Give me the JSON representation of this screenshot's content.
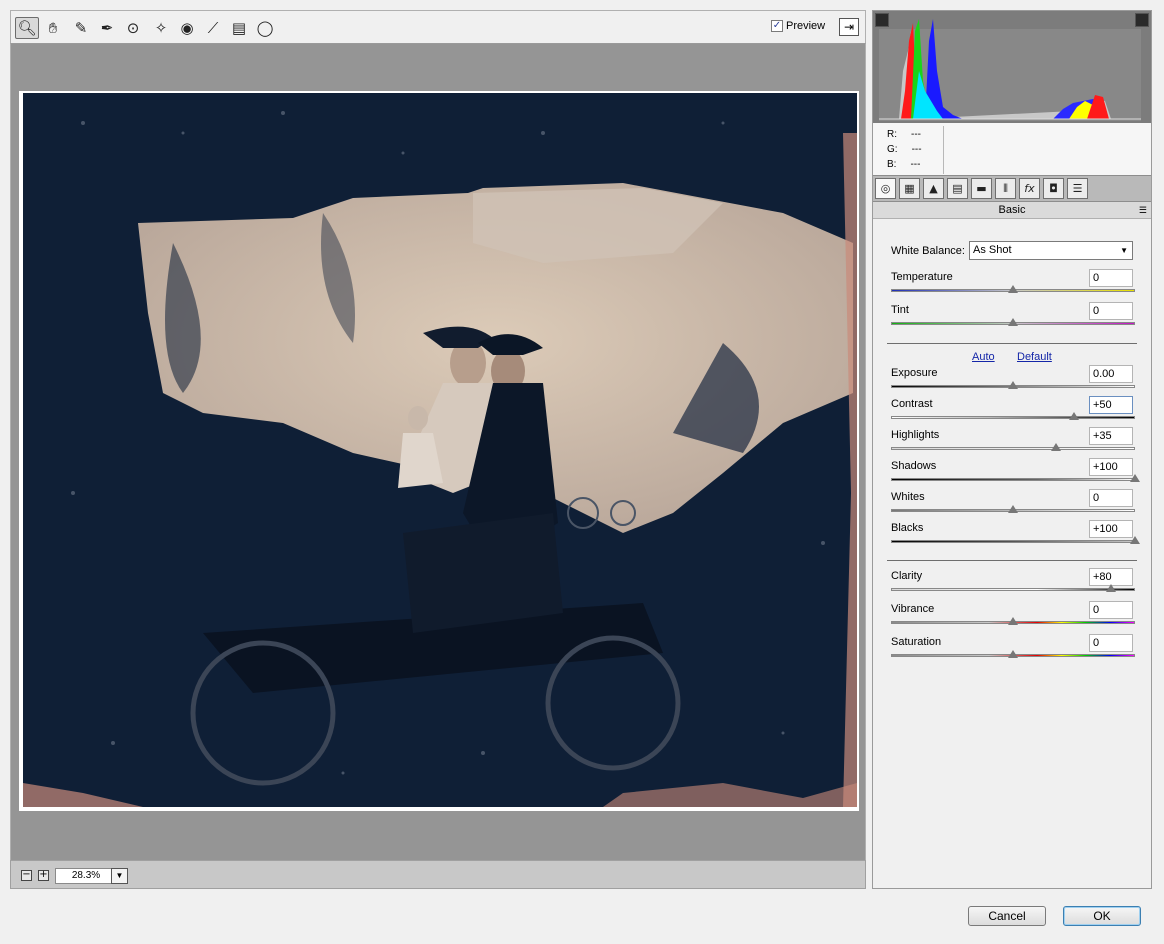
{
  "toolbar": {
    "preview_label": "Preview",
    "preview_checked": "✓"
  },
  "zoom": {
    "value": "28.3%",
    "minus": "−",
    "plus": "+"
  },
  "readout": {
    "r_label": "R:",
    "r_value": "---",
    "g_label": "G:",
    "g_value": "---",
    "b_label": "B:",
    "b_value": "---"
  },
  "panel": {
    "title": "Basic",
    "white_balance_label": "White Balance:",
    "white_balance_value": "As Shot",
    "auto_link": "Auto",
    "default_link": "Default",
    "sliders": [
      {
        "label": "Temperature",
        "value": "0",
        "position": 0.5
      },
      {
        "label": "Tint",
        "value": "0",
        "position": 0.5
      },
      {
        "label": "Exposure",
        "value": "0.00",
        "position": 0.5
      },
      {
        "label": "Contrast",
        "value": "+50",
        "position": 0.75
      },
      {
        "label": "Highlights",
        "value": "+35",
        "position": 0.675
      },
      {
        "label": "Shadows",
        "value": "+100",
        "position": 1.0
      },
      {
        "label": "Whites",
        "value": "0",
        "position": 0.5
      },
      {
        "label": "Blacks",
        "value": "+100",
        "position": 1.0
      },
      {
        "label": "Clarity",
        "value": "+80",
        "position": 0.9
      },
      {
        "label": "Vibrance",
        "value": "0",
        "position": 0.5
      },
      {
        "label": "Saturation",
        "value": "0",
        "position": 0.5
      }
    ]
  },
  "buttons": {
    "cancel": "Cancel",
    "ok": "OK"
  },
  "colors": {
    "photo_dark": "#0f1f36",
    "photo_light": "#d8c6b4",
    "photo_edge": "#c98a7a",
    "link": "#1426a8"
  }
}
